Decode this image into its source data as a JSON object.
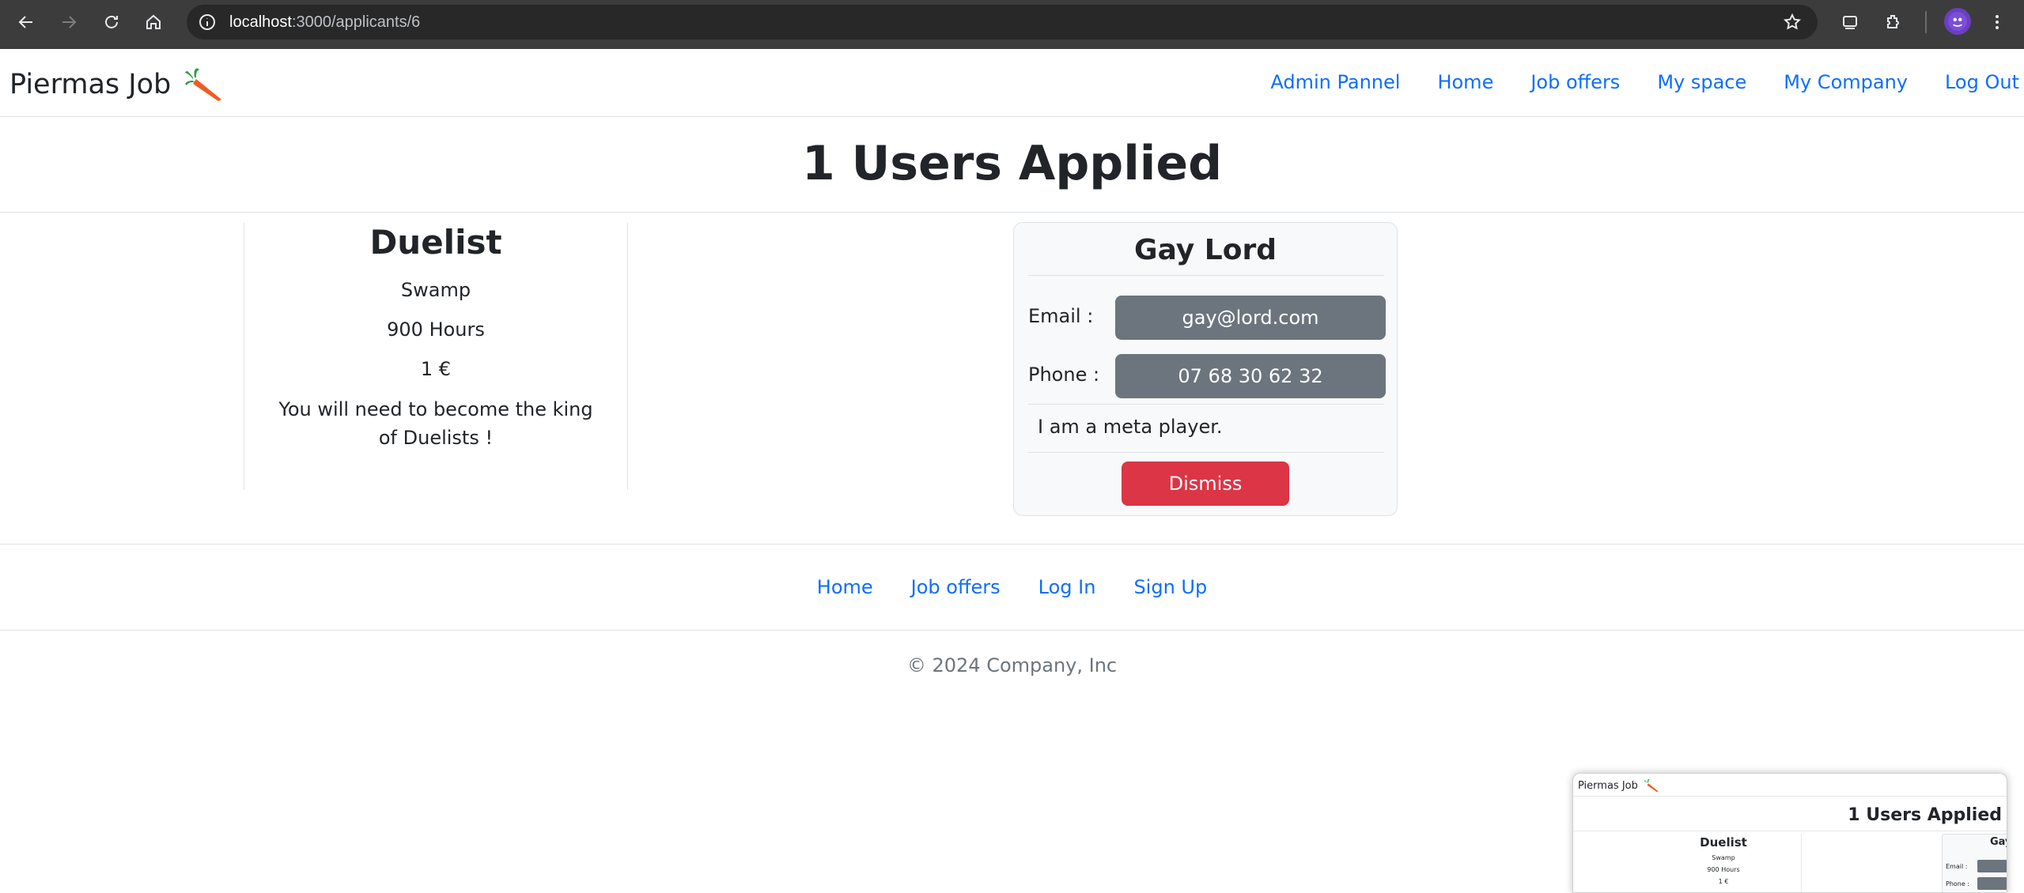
{
  "browser": {
    "url_host": "localhost",
    "url_path": ":3000/applicants/6"
  },
  "nav": {
    "brand": "Piermas Job",
    "links": [
      "Admin Pannel",
      "Home",
      "Job offers",
      "My space",
      "My Company",
      "Log Out"
    ]
  },
  "page": {
    "title": "1 Users Applied"
  },
  "job": {
    "title": "Duelist",
    "location": "Swamp",
    "hours": "900 Hours",
    "salary": "1 €",
    "description": "You will need to become the king of Duelists !"
  },
  "applicant": {
    "name": "Gay Lord",
    "email_label": "Email :",
    "email": "gay@lord.com",
    "phone_label": "Phone :",
    "phone": "07 68 30 62 32",
    "bio": "I am a meta player.",
    "dismiss_label": "Dismiss"
  },
  "footer": {
    "links": [
      "Home",
      "Job offers",
      "Log In",
      "Sign Up"
    ],
    "copyright": "© 2024 Company, Inc"
  },
  "thumbnail": {
    "brand": "Piermas Job",
    "title": "1 Users Applied",
    "job_title": "Duelist",
    "job_location": "Swamp",
    "job_hours": "900 Hours",
    "job_salary": "1 €",
    "applicant_name_partial": "Gay",
    "email_label": "Email :",
    "phone_label": "Phone :"
  },
  "colors": {
    "link": "#0d6efd",
    "danger": "#dc3545",
    "secondary": "#6c757d"
  }
}
